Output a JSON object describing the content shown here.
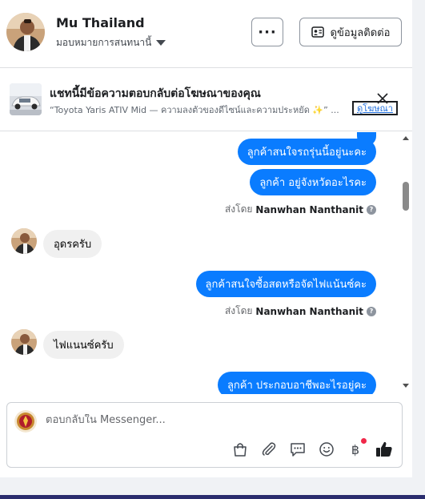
{
  "header": {
    "page_name": "Mu Thailand",
    "assign_label": "มอบหมายการสนทนานี้",
    "more_label": "···",
    "contact_label": "ดูข้อมูลติดต่อ"
  },
  "ad_banner": {
    "title": "แชทนี้มีข้อความตอบกลับต่อโฆษณาของคุณ",
    "subtitle": "“Toyota Yaris ATIV Mid — ความลงตัวของดีไซน์และความประหยัด ✨” ...",
    "view_ad_label": "ดูโฆษณา"
  },
  "messages": {
    "out_1": "ลูกค้าสนใจรถรุ่นนี้อยู่นะคะ",
    "out_2": "ลูกค้า อยู่จังหวัดอะไรคะ",
    "sent_by_1_prefix": "ส่งโดย",
    "sent_by_1_name": "Nanwhan Nanthanit",
    "in_1": "อุดรครับ",
    "out_3": "ลูกค้าสนใจซื้อสดหรือจัดไฟแน้นซ์คะ",
    "sent_by_2_prefix": "ส่งโดย",
    "sent_by_2_name": "Nanwhan Nanthanit",
    "in_2": "ไฟแนนซ์ครับ",
    "out_4": "ลูกค้า  ประกอบอาชีพอะไรอยู่คะ"
  },
  "composer": {
    "placeholder": "ตอบกลับใน Messenger..."
  },
  "colors": {
    "bubble_out": "#0a7cff",
    "bubble_in": "#f0f0f0",
    "like_icon": "#1c1e21",
    "notification_dot": "#f02849",
    "link": "#216fdb"
  }
}
